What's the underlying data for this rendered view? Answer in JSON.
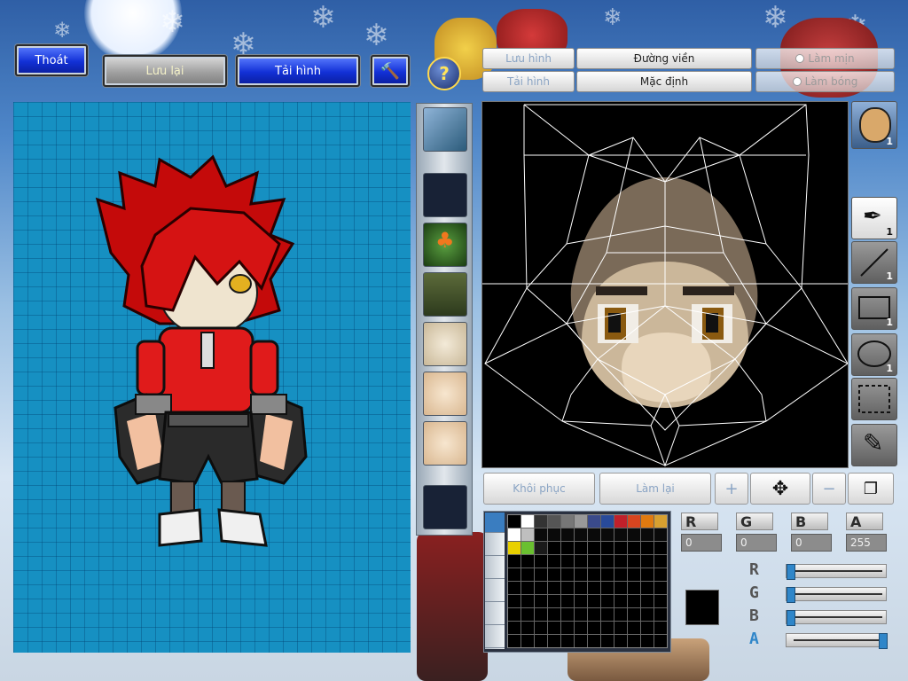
{
  "top_buttons": {
    "exit": "Thoát",
    "save": "Lưu lại",
    "reload": "Tải hình"
  },
  "tools_top": {
    "save_image": "Lưu hình",
    "load_image": "Tải hình",
    "outline": "Đường viền",
    "default": "Mặc định",
    "smooth": "Làm mịn",
    "shading": "Làm bóng"
  },
  "bottom_buttons": {
    "restore": "Khôi phục",
    "redo": "Làm lại"
  },
  "tool_counts": {
    "face": "1",
    "pen": "1",
    "line": "1",
    "rect": "1",
    "ellipse": "1"
  },
  "color": {
    "r_label": "R",
    "g_label": "G",
    "b_label": "B",
    "a_label": "A",
    "r": "0",
    "g": "0",
    "b": "0",
    "a": "255",
    "r_level": 0.0,
    "g_level": 0.0,
    "b_level": 0.0,
    "a_level": 1.0
  },
  "palette": [
    "#000000",
    "#ffffff",
    "#333333",
    "#555555",
    "#777777",
    "#999999",
    "#3a4a8a",
    "#284a9a",
    "#c0202a",
    "#d8451f",
    "#e07a10",
    "#d8a030",
    "#ffffff",
    "#bfbfbf",
    "#0a0a0a",
    "#0a0a0a",
    "#0a0a0a",
    "#0a0a0a",
    "#0a0a0a",
    "#0a0a0a",
    "#0a0a0a",
    "#0a0a0a",
    "#0a0a0a",
    "#0a0a0a",
    "#e8d000",
    "#6ac030",
    "#1a1a1a"
  ]
}
